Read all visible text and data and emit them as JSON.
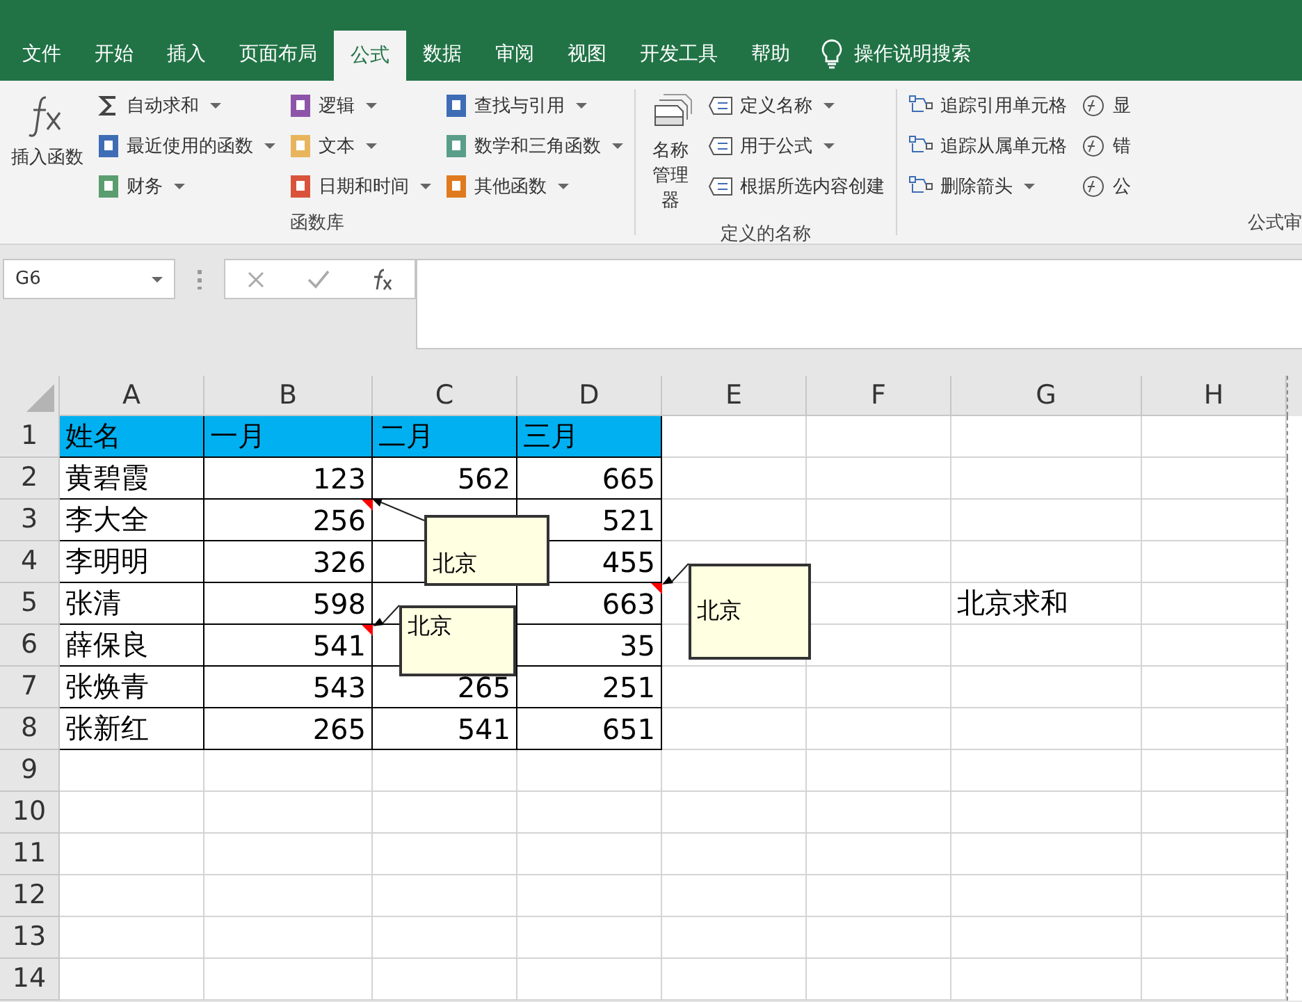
{
  "tabs": [
    {
      "label": "文件",
      "selected": false
    },
    {
      "label": "开始",
      "selected": false
    },
    {
      "label": "插入",
      "selected": false
    },
    {
      "label": "页面布局",
      "selected": false
    },
    {
      "label": "公式",
      "selected": true
    },
    {
      "label": "数据",
      "selected": false
    },
    {
      "label": "审阅",
      "selected": false
    },
    {
      "label": "视图",
      "selected": false
    },
    {
      "label": "开发工具",
      "selected": false
    },
    {
      "label": "帮助",
      "selected": false
    }
  ],
  "tell_me": "操作说明搜索",
  "ribbon": {
    "insert_function": "插入函数",
    "function_library": {
      "label": "函数库",
      "columns": [
        [
          {
            "label": "自动求和",
            "kind": "sigma",
            "color": "#444444",
            "dropdown": true
          },
          {
            "label": "最近使用的函数",
            "kind": "book",
            "color": "#3e6db5",
            "dropdown": true
          },
          {
            "label": "财务",
            "kind": "book",
            "color": "#5a9e6f",
            "dropdown": true
          }
        ],
        [
          {
            "label": "逻辑",
            "kind": "book",
            "color": "#8e54a9",
            "dropdown": true
          },
          {
            "label": "文本",
            "kind": "book",
            "color": "#e8b55e",
            "dropdown": true
          },
          {
            "label": "日期和时间",
            "kind": "book",
            "color": "#d9533c",
            "dropdown": true
          }
        ],
        [
          {
            "label": "查找与引用",
            "kind": "book",
            "color": "#3e6db5",
            "dropdown": true
          },
          {
            "label": "数学和三角函数",
            "kind": "book",
            "color": "#5a9e8a",
            "dropdown": true
          },
          {
            "label": "其他函数",
            "kind": "book",
            "color": "#e07a1f",
            "dropdown": true
          }
        ]
      ]
    },
    "defined_names": {
      "label": "定义的名称",
      "manager": "名称管理器",
      "items": [
        {
          "label": "定义名称",
          "dropdown": true
        },
        {
          "label": "用于公式",
          "dropdown": true
        },
        {
          "label": "根据所选内容创建",
          "dropdown": false
        }
      ]
    },
    "auditing": {
      "label": "公式审",
      "items": [
        {
          "label": "追踪引用单元格",
          "dropdown": false
        },
        {
          "label": "追踪从属单元格",
          "dropdown": false
        },
        {
          "label": "删除箭头",
          "dropdown": true
        }
      ],
      "cut_items": [
        "显",
        "错",
        "公"
      ]
    }
  },
  "name_box": "G6",
  "columns": [
    "A",
    "B",
    "C",
    "D",
    "E",
    "F",
    "G",
    "H"
  ],
  "rows": [
    {
      "num": "1",
      "highlighted": true,
      "bordered": true,
      "cells": [
        {
          "text": "姓名"
        },
        {
          "text": "一月"
        },
        {
          "text": "二月"
        },
        {
          "text": "三月"
        },
        {
          "text": ""
        },
        {
          "text": ""
        },
        {
          "text": ""
        },
        {
          "text": ""
        }
      ]
    },
    {
      "num": "2",
      "highlighted": false,
      "bordered": true,
      "cells": [
        {
          "text": "黄碧霞"
        },
        {
          "text": "123"
        },
        {
          "text": "562"
        },
        {
          "text": "665"
        },
        {
          "text": ""
        },
        {
          "text": ""
        },
        {
          "text": ""
        },
        {
          "text": ""
        }
      ]
    },
    {
      "num": "3",
      "highlighted": false,
      "bordered": true,
      "cells": [
        {
          "text": "李大全"
        },
        {
          "text": "256",
          "comment": "北京"
        },
        {
          "text": ""
        },
        {
          "text": "521"
        },
        {
          "text": ""
        },
        {
          "text": ""
        },
        {
          "text": ""
        },
        {
          "text": ""
        }
      ]
    },
    {
      "num": "4",
      "highlighted": false,
      "bordered": true,
      "cells": [
        {
          "text": "李明明"
        },
        {
          "text": "326"
        },
        {
          "text": ""
        },
        {
          "text": "455"
        },
        {
          "text": ""
        },
        {
          "text": ""
        },
        {
          "text": ""
        },
        {
          "text": ""
        }
      ]
    },
    {
      "num": "5",
      "highlighted": false,
      "bordered": true,
      "cells": [
        {
          "text": "张清"
        },
        {
          "text": "598"
        },
        {
          "text": ""
        },
        {
          "text": "663",
          "comment": "北京"
        },
        {
          "text": ""
        },
        {
          "text": ""
        },
        {
          "text": "北京求和"
        },
        {
          "text": ""
        }
      ]
    },
    {
      "num": "6",
      "highlighted": false,
      "bordered": true,
      "cells": [
        {
          "text": "薛保良"
        },
        {
          "text": "541",
          "comment": "北京"
        },
        {
          "text": ""
        },
        {
          "text": "35"
        },
        {
          "text": ""
        },
        {
          "text": ""
        },
        {
          "text": ""
        },
        {
          "text": ""
        }
      ]
    },
    {
      "num": "7",
      "highlighted": false,
      "bordered": true,
      "cells": [
        {
          "text": "张焕青"
        },
        {
          "text": "543"
        },
        {
          "text": "265"
        },
        {
          "text": "251"
        },
        {
          "text": ""
        },
        {
          "text": ""
        },
        {
          "text": ""
        },
        {
          "text": ""
        }
      ]
    },
    {
      "num": "8",
      "highlighted": false,
      "bordered": true,
      "cells": [
        {
          "text": "张新红"
        },
        {
          "text": "265"
        },
        {
          "text": "541"
        },
        {
          "text": "651"
        },
        {
          "text": ""
        },
        {
          "text": ""
        },
        {
          "text": ""
        },
        {
          "text": ""
        }
      ]
    },
    {
      "num": "9",
      "highlighted": false,
      "bordered": false,
      "cells": []
    },
    {
      "num": "10",
      "highlighted": false,
      "bordered": false,
      "cells": []
    },
    {
      "num": "11",
      "highlighted": false,
      "bordered": false,
      "cells": []
    },
    {
      "num": "12",
      "highlighted": false,
      "bordered": false,
      "cells": []
    },
    {
      "num": "13",
      "highlighted": false,
      "bordered": false,
      "cells": []
    },
    {
      "num": "14",
      "highlighted": false,
      "bordered": false,
      "cells": []
    }
  ]
}
